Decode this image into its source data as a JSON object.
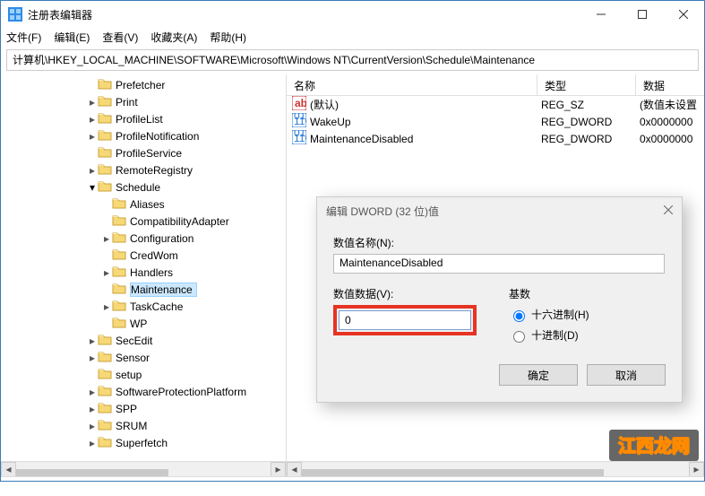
{
  "window": {
    "title": "注册表编辑器"
  },
  "menus": [
    "文件(F)",
    "编辑(E)",
    "查看(V)",
    "收藏夹(A)",
    "帮助(H)"
  ],
  "address": "计算机\\HKEY_LOCAL_MACHINE\\SOFTWARE\\Microsoft\\Windows NT\\CurrentVersion\\Schedule\\Maintenance",
  "tree": [
    {
      "indent": 6,
      "chev": "",
      "label": "Prefetcher"
    },
    {
      "indent": 6,
      "chev": ">",
      "label": "Print"
    },
    {
      "indent": 6,
      "chev": ">",
      "label": "ProfileList"
    },
    {
      "indent": 6,
      "chev": ">",
      "label": "ProfileNotification"
    },
    {
      "indent": 6,
      "chev": "",
      "label": "ProfileService"
    },
    {
      "indent": 6,
      "chev": ">",
      "label": "RemoteRegistry"
    },
    {
      "indent": 6,
      "chev": "v",
      "label": "Schedule"
    },
    {
      "indent": 7,
      "chev": "",
      "label": "Aliases"
    },
    {
      "indent": 7,
      "chev": "",
      "label": "CompatibilityAdapter"
    },
    {
      "indent": 7,
      "chev": ">",
      "label": "Configuration"
    },
    {
      "indent": 7,
      "chev": "",
      "label": "CredWom"
    },
    {
      "indent": 7,
      "chev": ">",
      "label": "Handlers"
    },
    {
      "indent": 7,
      "chev": "",
      "label": "Maintenance",
      "selected": true
    },
    {
      "indent": 7,
      "chev": ">",
      "label": "TaskCache"
    },
    {
      "indent": 7,
      "chev": "",
      "label": "WP"
    },
    {
      "indent": 6,
      "chev": ">",
      "label": "SecEdit"
    },
    {
      "indent": 6,
      "chev": ">",
      "label": "Sensor"
    },
    {
      "indent": 6,
      "chev": "",
      "label": "setup"
    },
    {
      "indent": 6,
      "chev": ">",
      "label": "SoftwareProtectionPlatform"
    },
    {
      "indent": 6,
      "chev": ">",
      "label": "SPP"
    },
    {
      "indent": 6,
      "chev": ">",
      "label": "SRUM"
    },
    {
      "indent": 6,
      "chev": ">",
      "label": "Superfetch"
    }
  ],
  "listHeaders": {
    "name": "名称",
    "type": "类型",
    "data": "数据"
  },
  "listRows": [
    {
      "icon": "str",
      "name": "(默认)",
      "type": "REG_SZ",
      "data": "(数值未设置"
    },
    {
      "icon": "dw",
      "name": "WakeUp",
      "type": "REG_DWORD",
      "data": "0x0000000"
    },
    {
      "icon": "dw",
      "name": "MaintenanceDisabled",
      "type": "REG_DWORD",
      "data": "0x0000000"
    }
  ],
  "dialog": {
    "title": "编辑 DWORD (32 位)值",
    "nameLabel": "数值名称(N):",
    "nameValue": "MaintenanceDisabled",
    "dataLabel": "数值数据(V):",
    "dataValue": "0",
    "baseLabel": "基数",
    "radioHex": "十六进制(H)",
    "radioDec": "十进制(D)",
    "ok": "确定",
    "cancel": "取消"
  },
  "watermark": "江西龙网"
}
